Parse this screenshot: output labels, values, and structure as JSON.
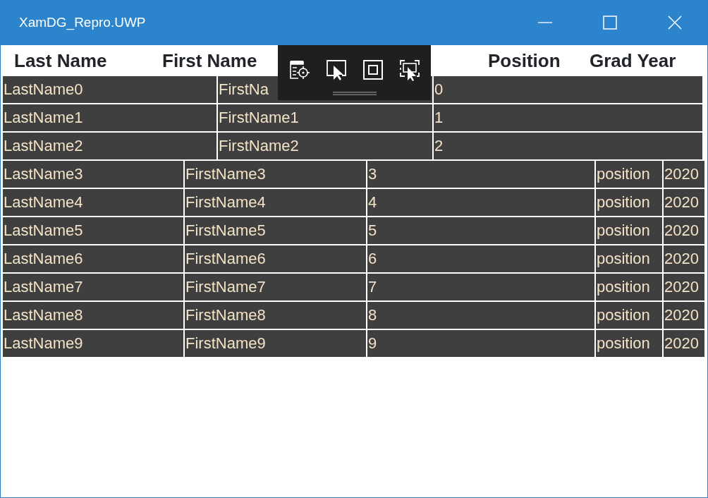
{
  "window": {
    "title": "XamDG_Repro.UWP",
    "controls": [
      {
        "kind": "minimize"
      },
      {
        "kind": "maximize"
      },
      {
        "kind": "close"
      }
    ]
  },
  "columns": [
    "Last Name",
    "First Name",
    "Position",
    "Grad Year"
  ],
  "toolbar": {
    "tools": [
      {
        "kind": "select-element"
      },
      {
        "kind": "pointer"
      },
      {
        "kind": "bounds"
      },
      {
        "kind": "track-focus"
      }
    ]
  },
  "rows": [
    {
      "kind": "three",
      "cells": [
        "LastName0",
        "FirstNa",
        "0"
      ]
    },
    {
      "kind": "three",
      "cells": [
        "LastName1",
        "FirstName1",
        "1"
      ]
    },
    {
      "kind": "three",
      "cells": [
        "LastName2",
        "FirstName2",
        "2"
      ]
    },
    {
      "kind": "five",
      "cells": [
        "LastName3",
        "FirstName3",
        "3",
        "position",
        "2020"
      ]
    },
    {
      "kind": "five",
      "cells": [
        "LastName4",
        "FirstName4",
        "4",
        "position",
        "2020"
      ]
    },
    {
      "kind": "five",
      "cells": [
        "LastName5",
        "FirstName5",
        "5",
        "position",
        "2020"
      ]
    },
    {
      "kind": "five",
      "cells": [
        "LastName6",
        "FirstName6",
        "6",
        "position",
        "2020"
      ]
    },
    {
      "kind": "five",
      "cells": [
        "LastName7",
        "FirstName7",
        "7",
        "position",
        "2020"
      ]
    },
    {
      "kind": "five",
      "cells": [
        "LastName8",
        "FirstName8",
        "8",
        "position",
        "2020"
      ]
    },
    {
      "kind": "five",
      "cells": [
        "LastName9",
        "FirstName9",
        "9",
        "position",
        "2020"
      ]
    }
  ]
}
